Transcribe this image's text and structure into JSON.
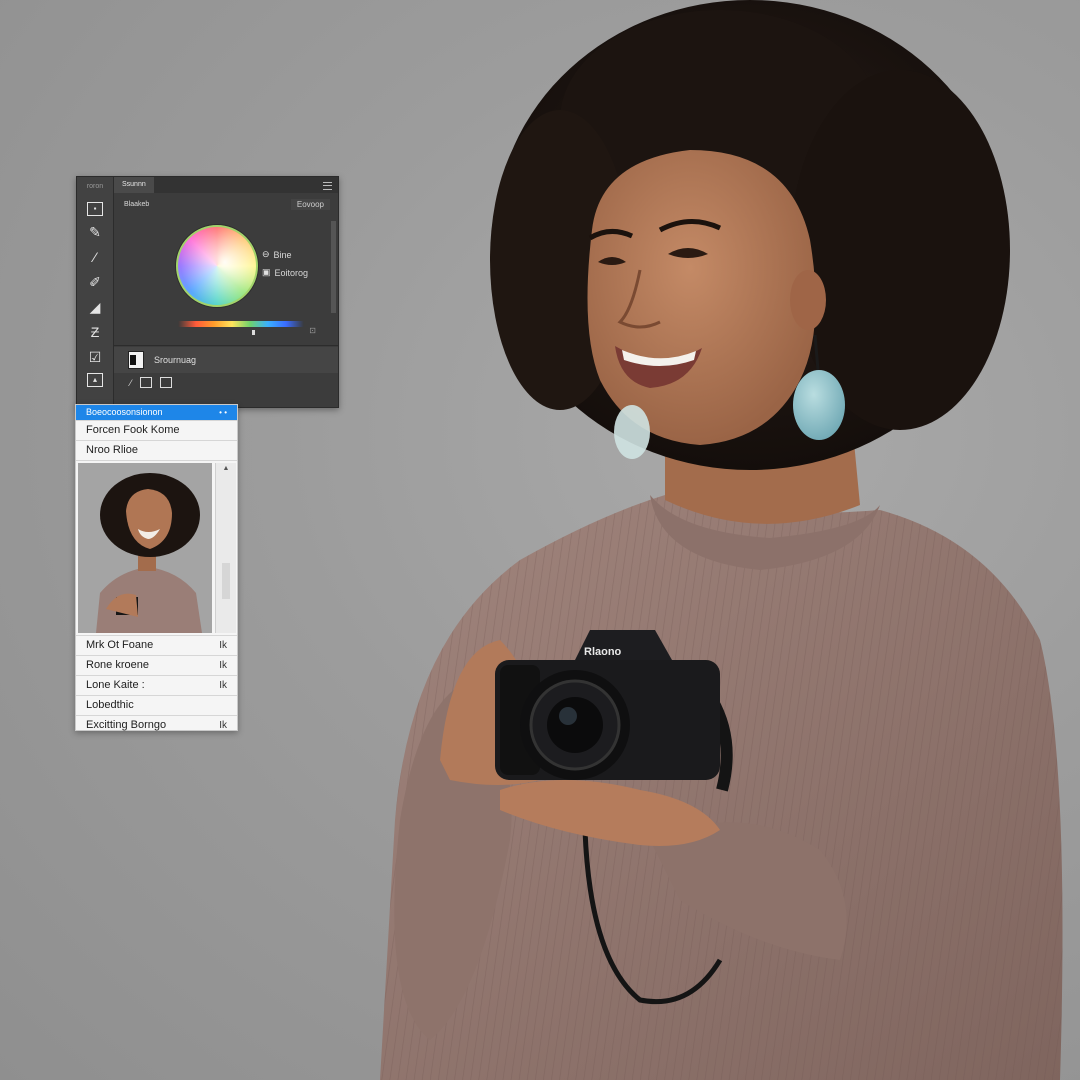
{
  "toolbar": {
    "header": "roron",
    "tools": [
      "marquee-icon",
      "pen-icon",
      "brush-icon",
      "pencil-icon",
      "eraser-icon",
      "path-icon",
      "check-tool-icon",
      "transform-icon"
    ]
  },
  "panel": {
    "tab_label": "Ssunnn",
    "sub_left": "Blaakeb",
    "sub_right": "Eovoop",
    "option_1": "Bine",
    "option_2": "Eoitorog",
    "layer_name": "Srournuag",
    "wheel_colors": [
      "#ff5a5a",
      "#ffb347",
      "#fff36b",
      "#8be36b",
      "#55d6c8",
      "#5aa7ff",
      "#9b7bff",
      "#ff6bd6"
    ]
  },
  "menu": {
    "highlight": "Boeocoosonsionon",
    "highlight_dots": "• •",
    "items_top": [
      "Forcen Fook Kome",
      "Nroo Rlioe"
    ],
    "items_bottom": [
      {
        "label": "Mrk Ot Foane",
        "shortcut": "Ik"
      },
      {
        "label": "Rone kroene",
        "shortcut": "Ik"
      },
      {
        "label": "Lone Kaite :",
        "shortcut": "Ik"
      },
      {
        "label": "Lobedthic",
        "shortcut": ""
      },
      {
        "label": "Excitting Borngo",
        "shortcut": "Ik"
      }
    ]
  },
  "camera": {
    "brand": "Rlaono"
  },
  "colors": {
    "background": "#9c9c9c",
    "sweater": "#977a72",
    "highlight_blue": "#1e86e8",
    "panel_dark": "#3c3c3c"
  }
}
